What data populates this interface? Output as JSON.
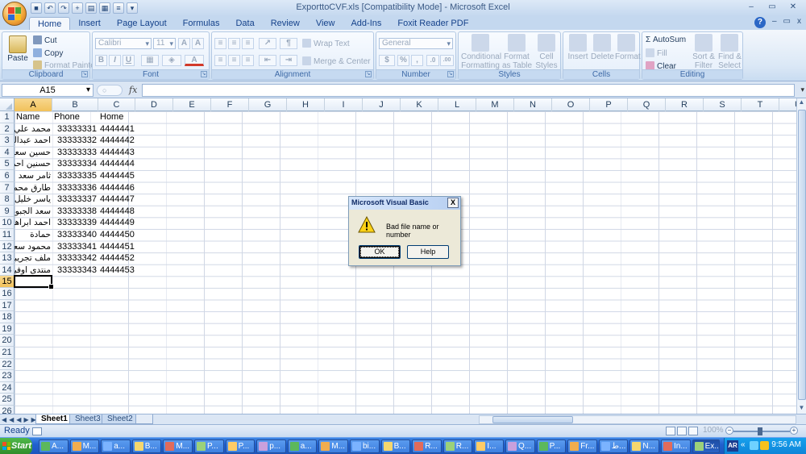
{
  "window": {
    "title": "ExporttoCVF.xls  [Compatibility Mode] - Microsoft Excel",
    "controls": [
      "–",
      "▭",
      "✕"
    ],
    "doc_controls": [
      "–",
      "▭",
      "x"
    ]
  },
  "ribbon": {
    "tabs": [
      "Home",
      "Insert",
      "Page Layout",
      "Formulas",
      "Data",
      "Review",
      "View",
      "Add-Ins",
      "Foxit Reader PDF"
    ],
    "active_tab": "Home",
    "clipboard": {
      "label": "Clipboard",
      "paste": "Paste",
      "cut": "Cut",
      "copy": "Copy",
      "format_painter": "Format Painter"
    },
    "font": {
      "label": "Font",
      "name": "Calibri",
      "size": "11",
      "bold": "B",
      "italic": "I",
      "underline": "U"
    },
    "alignment": {
      "label": "Alignment",
      "wrap_text": "Wrap Text",
      "merge_center": "Merge & Center"
    },
    "number": {
      "label": "Number",
      "format": "General",
      "currency": "$",
      "percent": "%",
      "comma": ",",
      "dec_inc": ".0",
      "dec_dec": ".00"
    },
    "styles": {
      "label": "Styles",
      "conditional": "Conditional",
      "conditional2": "Formatting",
      "format_table": "Format",
      "format_table2": "as Table",
      "cell_styles": "Cell",
      "cell_styles2": "Styles"
    },
    "cells": {
      "label": "Cells",
      "insert": "Insert",
      "delete": "Delete",
      "format": "Format"
    },
    "editing": {
      "label": "Editing",
      "autosum": "AutoSum",
      "fill": "Fill",
      "clear": "Clear",
      "sort_filter": "Sort &",
      "sort_filter2": "Filter",
      "find_select": "Find &",
      "find_select2": "Select"
    }
  },
  "formula_bar": {
    "name_box": "A15",
    "fx": "fx",
    "value": ""
  },
  "grid": {
    "columns": [
      "A",
      "B",
      "C",
      "D",
      "E",
      "F",
      "G",
      "H",
      "I",
      "J",
      "K",
      "L",
      "M",
      "N",
      "O",
      "P",
      "Q",
      "R",
      "S",
      "T",
      "U"
    ],
    "selected_column": "A",
    "rows": [
      "1",
      "2",
      "3",
      "4",
      "5",
      "6",
      "7",
      "8",
      "9",
      "10",
      "11",
      "12",
      "13",
      "14",
      "15",
      "16",
      "17",
      "18",
      "19",
      "20",
      "21",
      "22",
      "23",
      "24",
      "25",
      "26"
    ],
    "selected_row": "15",
    "headers": [
      "Name",
      "Phone",
      "Home"
    ],
    "data": [
      [
        "محمد علي",
        "33333331",
        "4444441"
      ],
      [
        "احمد عبدالله",
        "33333332",
        "4444442"
      ],
      [
        "حسين سعيد",
        "33333333",
        "4444443"
      ],
      [
        "حسنين احمد",
        "33333334",
        "4444444"
      ],
      [
        "ثامر سعد",
        "33333335",
        "4444445"
      ],
      [
        "طارق محمود",
        "33333336",
        "4444446"
      ],
      [
        "ياسر خليل",
        "33333337",
        "4444447"
      ],
      [
        "سعد الجبوري",
        "33333338",
        "4444448"
      ],
      [
        "احمد ابراهيم",
        "33333339",
        "4444449"
      ],
      [
        "حمادة",
        "33333340",
        "4444450"
      ],
      [
        "محمود سعد",
        "33333341",
        "4444451"
      ],
      [
        "ملف تجريبي",
        "33333342",
        "4444452"
      ],
      [
        "منتدى اوفيسنا",
        "33333343",
        "4444453"
      ]
    ]
  },
  "sheets": {
    "tabs": [
      "Sheet1",
      "Sheet3",
      "Sheet2"
    ],
    "active": "Sheet1"
  },
  "status_bar": {
    "text": "Ready",
    "zoom": "100%"
  },
  "dialog": {
    "title": "Microsoft Visual Basic",
    "message": "Bad file name or number",
    "ok_label": "OK",
    "help_label": "Help",
    "close_label": "X",
    "icon": "warning-icon"
  },
  "taskbar": {
    "start_label": "Start",
    "tasks": [
      "A...",
      "M...",
      "a...",
      "B...",
      "M...",
      "P...",
      "P...",
      "p...",
      "a...",
      "M...",
      "bi...",
      "B...",
      "R...",
      "R...",
      "I...",
      "Q...",
      "P...",
      "Fr...",
      "ط...",
      "N...",
      "In...",
      "Ex..."
    ],
    "active_task": "Ex...",
    "language": "AR",
    "clock": "9:56 AM"
  },
  "colors": {
    "accent": "#15428b",
    "ribbon": "#dbe8f6",
    "taskbar": "#2161cf",
    "selection": "#f1c15a"
  }
}
